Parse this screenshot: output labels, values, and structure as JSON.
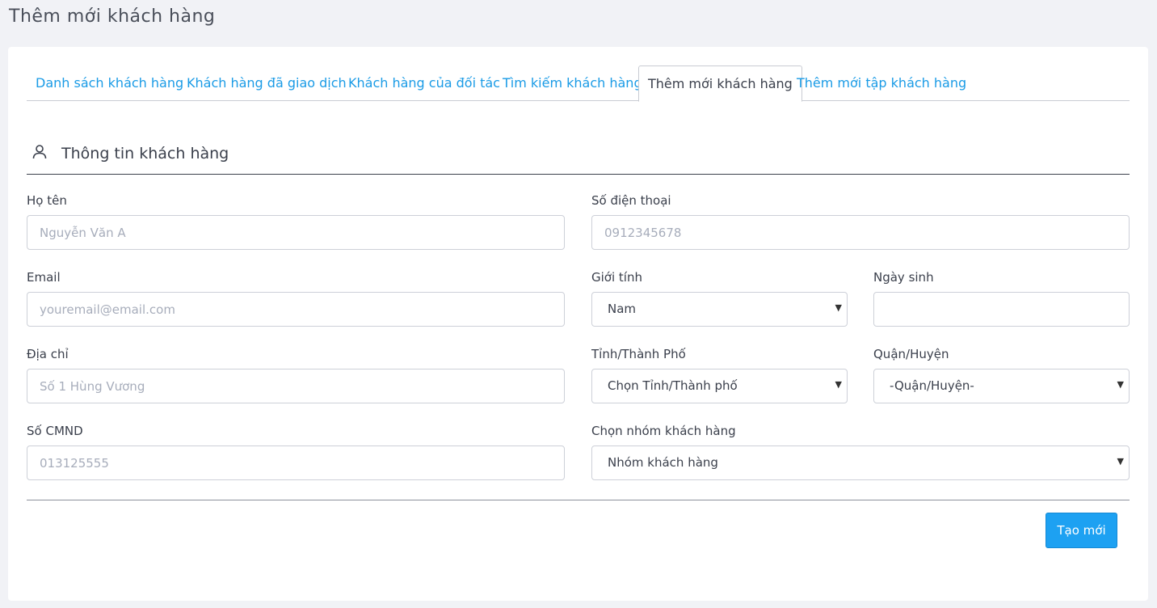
{
  "page": {
    "title": "Thêm mới khách hàng"
  },
  "tabs": [
    {
      "label": "Danh sách khách hàng"
    },
    {
      "label": "Khách hàng đã giao dịch"
    },
    {
      "label": "Khách hàng của đối tác"
    },
    {
      "label": "Tìm kiếm khách hàng"
    },
    {
      "label": "Thêm mới khách hàng",
      "active": true
    },
    {
      "label": "Thêm mới tập khách hàng"
    }
  ],
  "section": {
    "title": "Thông tin khách hàng",
    "icon": "user-icon"
  },
  "form": {
    "full_name": {
      "label": "Họ tên",
      "placeholder": "Nguyễn Văn A",
      "value": ""
    },
    "phone": {
      "label": "Số điện thoại",
      "placeholder": "0912345678",
      "value": ""
    },
    "email": {
      "label": "Email",
      "placeholder": "youremail@email.com",
      "value": ""
    },
    "gender": {
      "label": "Giới tính",
      "selected": "Nam"
    },
    "birthday": {
      "label": "Ngày sinh",
      "value": ""
    },
    "address": {
      "label": "Địa chỉ",
      "placeholder": "Số 1 Hùng Vương",
      "value": ""
    },
    "province": {
      "label": "Tỉnh/Thành Phố",
      "selected": "Chọn Tỉnh/Thành phố"
    },
    "district": {
      "label": "Quận/Huyện",
      "selected": "-Quận/Huyện-"
    },
    "id_number": {
      "label": "Số CMND",
      "placeholder": "013125555",
      "value": ""
    },
    "customer_group": {
      "label": "Chọn nhóm khách hàng",
      "selected": "Nhóm khách hàng"
    }
  },
  "actions": {
    "create_label": "Tạo mới"
  },
  "colors": {
    "accent": "#1da1f2",
    "link": "#1a9be6",
    "background": "#f1f2f6"
  }
}
